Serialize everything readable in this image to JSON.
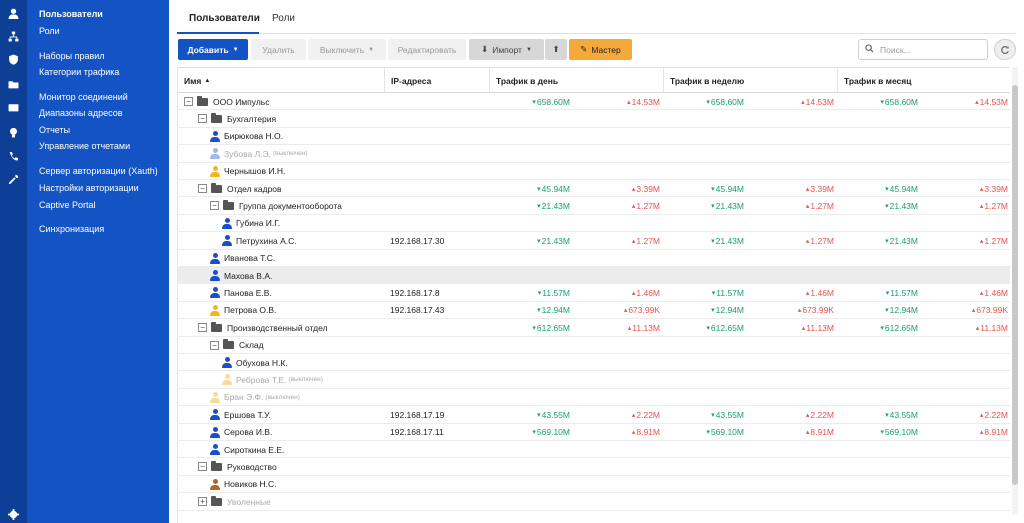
{
  "rail": {
    "icons": [
      "user-icon",
      "sitemap-icon",
      "shield-icon",
      "folder-icon",
      "mail-icon",
      "bulb-icon",
      "phone-icon",
      "wrench-icon",
      "gear-icon"
    ]
  },
  "sidebar": {
    "items": [
      {
        "label": "Пользователи"
      },
      {
        "label": "Роли"
      },
      {
        "label": "Наборы правил"
      },
      {
        "label": "Категории трафика"
      },
      {
        "label": "Монитор соединений"
      },
      {
        "label": "Диапазоны адресов"
      },
      {
        "label": "Отчеты"
      },
      {
        "label": "Управление отчетами"
      },
      {
        "label": "Сервер авторизации (Xauth)"
      },
      {
        "label": "Настройки авторизации"
      },
      {
        "label": "Captive Portal"
      },
      {
        "label": "Синхронизация"
      }
    ]
  },
  "tabs": [
    "Пользователи",
    "Роли"
  ],
  "toolbar": {
    "add": "Добавить",
    "delete": "Удалить",
    "disable": "Выключить",
    "edit": "Редактировать",
    "import": "Импорт",
    "wizard": "Мастер",
    "search_placeholder": "Поиск..."
  },
  "columns": {
    "name": "Имя",
    "ip": "IP-адреса",
    "day": "Трафик в день",
    "week": "Трафик в неделю",
    "month": "Трафик в месяц"
  },
  "disabled_tag": "(выключен)",
  "rows": [
    {
      "type": "group",
      "level": 0,
      "expand": "−",
      "name": "ООО Импульс",
      "ip": "",
      "down": "658.60M",
      "up": "14.53M"
    },
    {
      "type": "group",
      "level": 1,
      "expand": "−",
      "name": "Бухгалтерия",
      "ip": "",
      "down": "",
      "up": ""
    },
    {
      "type": "user",
      "level": 2,
      "name": "Бирюкова Н.О.",
      "color": "#1a4fc9",
      "ip": "",
      "down": "",
      "up": ""
    },
    {
      "type": "user",
      "level": 2,
      "name": "Зубова Л.Э.",
      "color": "#9fb8e6",
      "disabled": true,
      "ip": "",
      "down": "",
      "up": ""
    },
    {
      "type": "user",
      "level": 2,
      "name": "Чернышов И.Н.",
      "color": "#f2b51e",
      "ip": "",
      "down": "",
      "up": ""
    },
    {
      "type": "group",
      "level": 1,
      "expand": "−",
      "name": "Отдел кадров",
      "ip": "",
      "down": "45.94M",
      "up": "3.39M"
    },
    {
      "type": "group",
      "level": 2,
      "expand": "−",
      "name": "Группа документооборота",
      "ip": "",
      "down": "21.43M",
      "up": "1.27M"
    },
    {
      "type": "user",
      "level": 3,
      "name": "Губина И.Г.",
      "color": "#1a4fc9",
      "ip": "",
      "down": "",
      "up": ""
    },
    {
      "type": "user",
      "level": 3,
      "name": "Петрухина А.С.",
      "color": "#1a4fc9",
      "ip": "192.168.17.30",
      "down": "21.43M",
      "up": "1.27M"
    },
    {
      "type": "user",
      "level": 2,
      "name": "Иванова Т.С.",
      "color": "#1a4fc9",
      "ip": "",
      "down": "",
      "up": ""
    },
    {
      "type": "user",
      "level": 2,
      "name": "Махова В.А.",
      "color": "#1a4fc9",
      "highlight": true,
      "ip": "",
      "down": "",
      "up": ""
    },
    {
      "type": "user",
      "level": 2,
      "name": "Панова Е.В.",
      "color": "#1a4fc9",
      "ip": "192.168.17.8",
      "down": "11.57M",
      "up": "1.46M"
    },
    {
      "type": "user",
      "level": 2,
      "name": "Петрова О.В.",
      "color": "#f2b51e",
      "ip": "192.168.17.43",
      "down": "12.94M",
      "up": "673.99K"
    },
    {
      "type": "group",
      "level": 1,
      "expand": "−",
      "name": "Производственный отдел",
      "ip": "",
      "down": "612.65M",
      "up": "11.13M"
    },
    {
      "type": "group",
      "level": 2,
      "expand": "−",
      "name": "Склад",
      "ip": "",
      "down": "",
      "up": ""
    },
    {
      "type": "user",
      "level": 3,
      "name": "Обухова Н.К.",
      "color": "#1a4fc9",
      "ip": "",
      "down": "",
      "up": ""
    },
    {
      "type": "user",
      "level": 3,
      "name": "Реброва Т.Е.",
      "color": "#f5dc9a",
      "disabled": true,
      "ip": "",
      "down": "",
      "up": ""
    },
    {
      "type": "user",
      "level": 2,
      "name": "Бран Э.Ф.",
      "color": "#f5dc9a",
      "disabled": true,
      "ip": "",
      "down": "",
      "up": ""
    },
    {
      "type": "user",
      "level": 2,
      "name": "Ершова Т.У.",
      "color": "#1a4fc9",
      "ip": "192.168.17.19",
      "down": "43.55M",
      "up": "2.22M"
    },
    {
      "type": "user",
      "level": 2,
      "name": "Серова И.В.",
      "color": "#1a4fc9",
      "ip": "192.168.17.11",
      "down": "569.10M",
      "up": "8.91M"
    },
    {
      "type": "user",
      "level": 2,
      "name": "Сироткина Е.Е.",
      "color": "#1a4fc9",
      "ip": "",
      "down": "",
      "up": ""
    },
    {
      "type": "group",
      "level": 1,
      "expand": "−",
      "name": "Руководство",
      "ip": "",
      "down": "",
      "up": ""
    },
    {
      "type": "user",
      "level": 2,
      "name": "Новиков Н.С.",
      "color": "#b5622b",
      "ip": "",
      "down": "",
      "up": ""
    },
    {
      "type": "group",
      "level": 1,
      "expand": "+",
      "name": "Уволенные",
      "disabled": true,
      "ip": "",
      "down": "",
      "up": ""
    }
  ]
}
